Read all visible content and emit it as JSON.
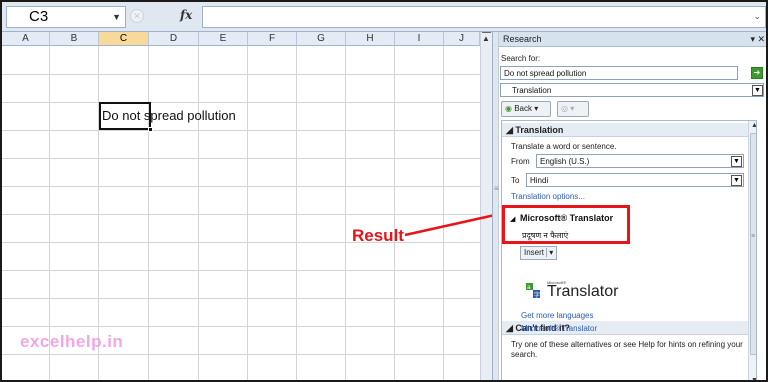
{
  "formula_bar": {
    "name_box": "C3",
    "fx_label": "fx",
    "formula_value": ""
  },
  "sheet": {
    "columns": [
      "A",
      "B",
      "C",
      "D",
      "E",
      "F",
      "G",
      "H",
      "I",
      "J"
    ],
    "selected_column": "C",
    "cell_text": "Do not spread pollution"
  },
  "watermark": "excelhelp.in",
  "annotation": {
    "label": "Result",
    "color": "#e8141a"
  },
  "research": {
    "title": "Research",
    "search_for_label": "Search for:",
    "search_value": "Do not spread pollution",
    "service": "Translation",
    "back_label": "Back",
    "translation": {
      "header": "Translation",
      "hint": "Translate a word or sentence.",
      "from_label": "From",
      "from_value": "English (U.S.)",
      "to_label": "To",
      "to_value": "Hindi",
      "options_link": "Translation options..."
    },
    "ms_translator": {
      "header": "Microsoft® Translator",
      "result_text": "प्रदूषण न फैलाएं",
      "insert_label": "Insert",
      "logo_small": "Microsoft®",
      "logo_name": "Translator",
      "more_languages": "Get more languages",
      "ms_link": "Microsoft® Translator"
    },
    "cant_find": {
      "header": "Can't find it?",
      "text": "Try one of these alternatives or see Help for hints on refining your search."
    }
  },
  "colors": {
    "selection": "#f9d99a",
    "header_bg": "#e3ebf5",
    "accent": "#2a5db0",
    "logo_green": "#3d9a2f"
  }
}
